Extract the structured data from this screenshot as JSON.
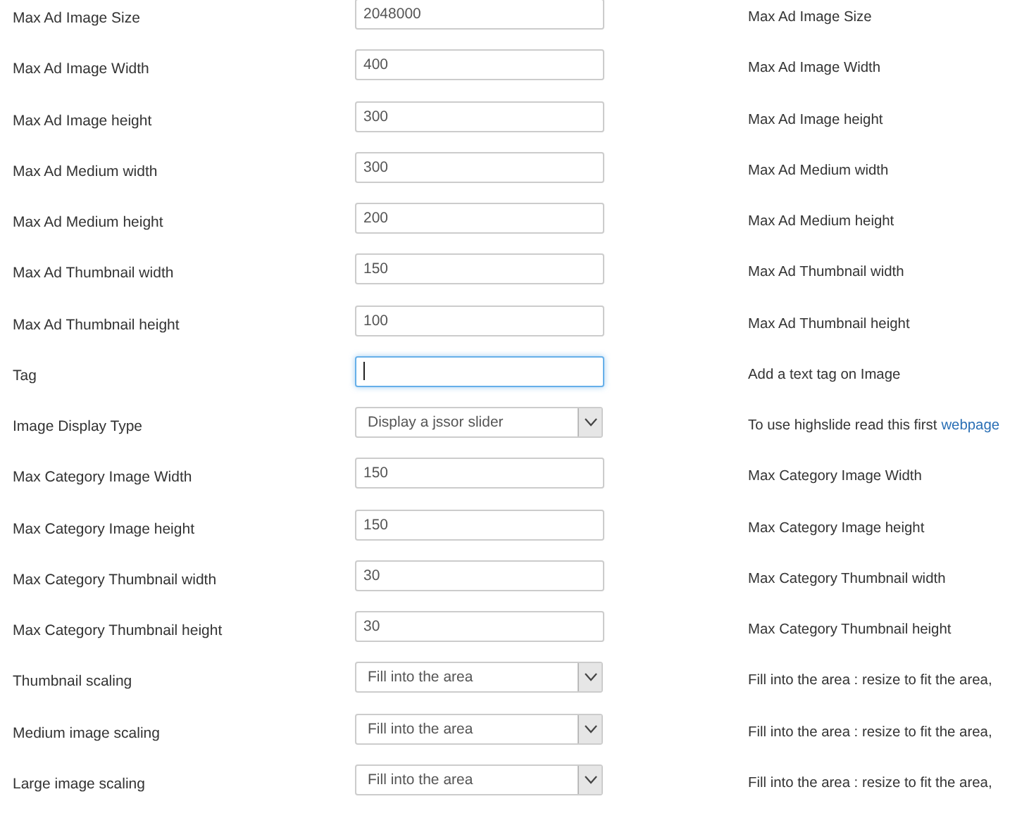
{
  "rows": [
    {
      "label": "Max Ad Image Size",
      "kind": "input",
      "value": "2048000",
      "description": {
        "text": "Max Ad Image Size"
      }
    },
    {
      "label": "Max Ad Image Width",
      "kind": "input",
      "value": "400",
      "description": {
        "text": "Max Ad Image Width"
      }
    },
    {
      "label": "Max Ad Image height",
      "kind": "input",
      "value": "300",
      "description": {
        "text": "Max Ad Image height"
      }
    },
    {
      "label": "Max Ad Medium width",
      "kind": "input",
      "value": "300",
      "description": {
        "text": "Max Ad Medium width"
      }
    },
    {
      "label": "Max Ad Medium height",
      "kind": "input",
      "value": "200",
      "description": {
        "text": "Max Ad Medium height"
      }
    },
    {
      "label": "Max Ad Thumbnail width",
      "kind": "input",
      "value": "150",
      "description": {
        "text": "Max Ad Thumbnail width"
      }
    },
    {
      "label": "Max Ad Thumbnail height",
      "kind": "input",
      "value": "100",
      "description": {
        "text": "Max Ad Thumbnail height"
      }
    },
    {
      "label": "Tag",
      "kind": "input",
      "focused": true,
      "description": {
        "text": "Add a text tag on Image"
      }
    },
    {
      "label": "Image Display Type",
      "kind": "select",
      "value": "Display a jssor slider",
      "description": {
        "text": "To use highslide read this first",
        "link": "webpage"
      }
    },
    {
      "label": "Max Category Image Width",
      "kind": "input",
      "value": "150",
      "description": {
        "text": "Max Category Image Width"
      }
    },
    {
      "label": "Max Category Image height",
      "kind": "input",
      "value": "150",
      "description": {
        "text": "Max Category Image height"
      }
    },
    {
      "label": "Max Category Thumbnail width",
      "kind": "input",
      "value": "30",
      "description": {
        "text": "Max Category Thumbnail width"
      }
    },
    {
      "label": "Max Category Thumbnail height",
      "kind": "input",
      "value": "30",
      "description": {
        "text": "Max Category Thumbnail height"
      }
    },
    {
      "label": "Thumbnail scaling",
      "kind": "select",
      "value": "Fill into the area",
      "description": {
        "text": "Fill into the area : resize to fit the area,"
      }
    },
    {
      "label": "Medium image scaling",
      "kind": "select",
      "value": "Fill into the area",
      "description": {
        "text": "Fill into the area : resize to fit the area,"
      }
    },
    {
      "label": "Large image scaling",
      "kind": "select",
      "value": "Fill into the area",
      "description": {
        "text": "Fill into the area : resize to fit the area,"
      }
    }
  ]
}
